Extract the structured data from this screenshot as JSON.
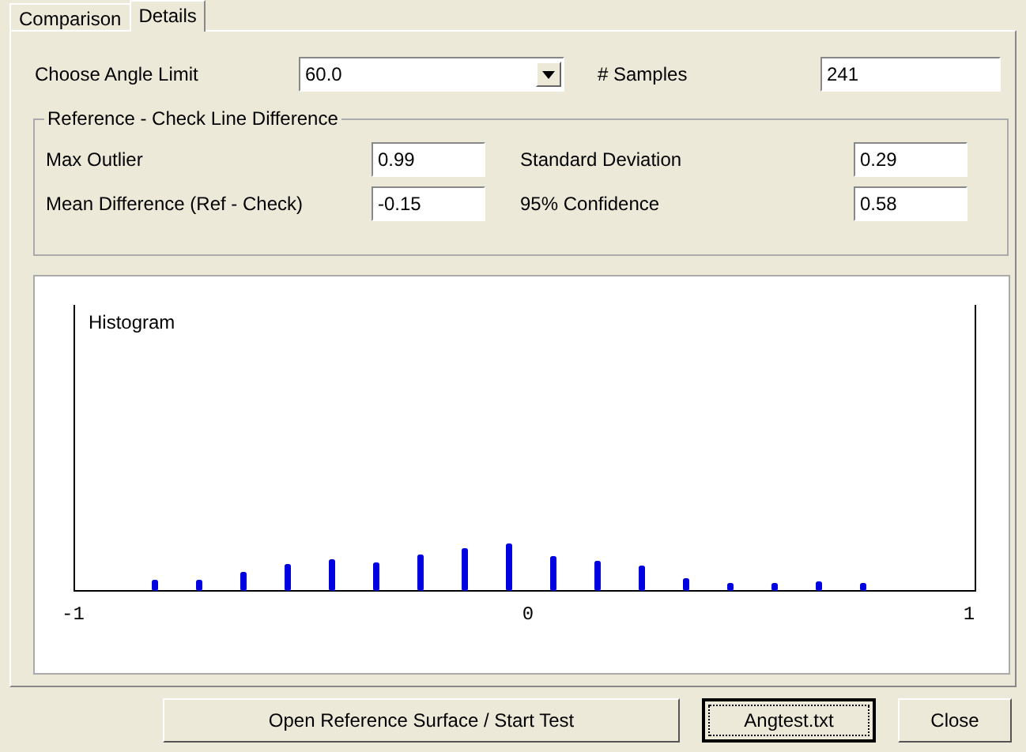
{
  "tabs": [
    {
      "label": "Comparison",
      "selected": false
    },
    {
      "label": "Details",
      "selected": true
    }
  ],
  "angle_limit": {
    "label": "Choose Angle Limit",
    "value": "60.0"
  },
  "samples": {
    "label": "# Samples",
    "value": "241"
  },
  "group": {
    "title": "Reference - Check Line Difference",
    "fields": [
      {
        "label": "Max Outlier",
        "value": "0.99"
      },
      {
        "label": "Standard Deviation",
        "value": "0.29"
      },
      {
        "label": "Mean Difference (Ref - Check)",
        "value": "-0.15"
      },
      {
        "label": "95% Confidence",
        "value": "0.58"
      }
    ]
  },
  "histogram": {
    "title": "Histogram",
    "axis_labels": [
      "-1",
      "0",
      "1"
    ]
  },
  "buttons": [
    {
      "label": "Open Reference Surface / Start Test",
      "focused": false
    },
    {
      "label": "Angtest.txt",
      "focused": true
    },
    {
      "label": "Close",
      "focused": false
    }
  ]
}
